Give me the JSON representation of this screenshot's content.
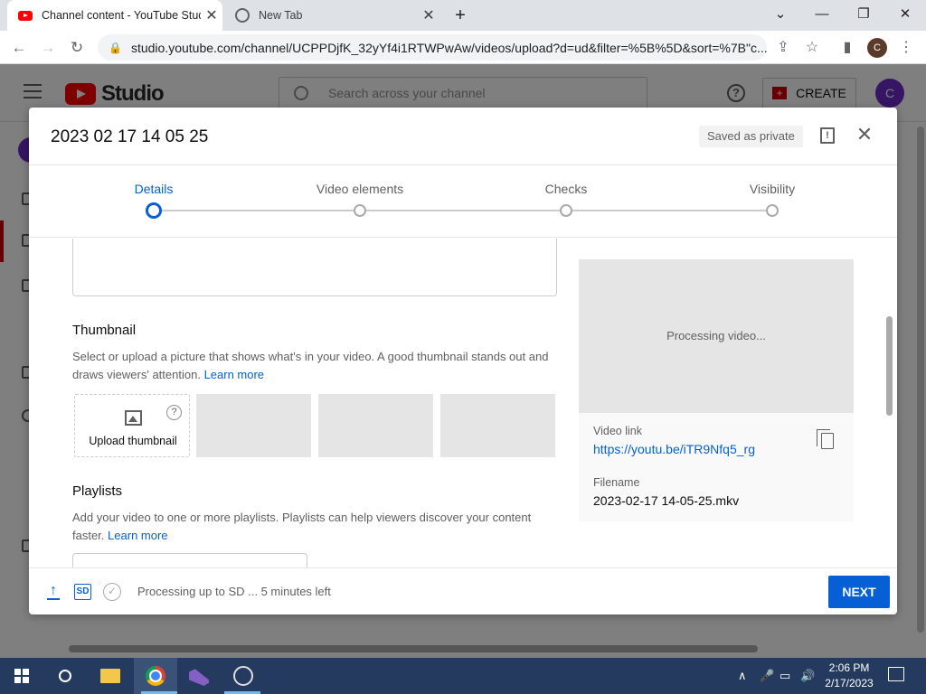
{
  "browser": {
    "tabs": [
      {
        "title": "Channel content - YouTube Studio",
        "active": true
      },
      {
        "title": "New Tab",
        "active": false
      }
    ],
    "url": "studio.youtube.com/channel/UCPPDjfK_32yYf4i1RTWPwAw/videos/upload?d=ud&filter=%5B%5D&sort=%7B\"c...",
    "profile_initial": "C"
  },
  "studio": {
    "logo_text": "Studio",
    "search_placeholder": "Search across your channel",
    "create_label": "CREATE",
    "avatar_initial": "C"
  },
  "dialog": {
    "title": "2023 02 17 14 05 25",
    "saved_badge": "Saved as private",
    "steps": [
      {
        "label": "Details",
        "active": true
      },
      {
        "label": "Video elements",
        "active": false
      },
      {
        "label": "Checks",
        "active": false
      },
      {
        "label": "Visibility",
        "active": false
      }
    ],
    "thumbnail": {
      "title": "Thumbnail",
      "description": "Select or upload a picture that shows what's in your video. A good thumbnail stands out and draws viewers' attention.",
      "learn_more": "Learn more",
      "upload_label": "Upload thumbnail",
      "help_glyph": "?"
    },
    "playlists": {
      "title": "Playlists",
      "description": "Add your video to one or more playlists. Playlists can help viewers discover your content faster.",
      "learn_more": "Learn more"
    },
    "preview": {
      "processing_text": "Processing video...",
      "video_link_label": "Video link",
      "video_link": "https://youtu.be/iTR9Nfq5_rg",
      "filename_label": "Filename",
      "filename": "2023-02-17 14-05-25.mkv"
    },
    "footer": {
      "sd_badge": "SD",
      "status": "Processing up to SD ... 5 minutes left",
      "next_label": "NEXT"
    }
  },
  "taskbar": {
    "time": "2:06 PM",
    "date": "2/17/2023"
  }
}
